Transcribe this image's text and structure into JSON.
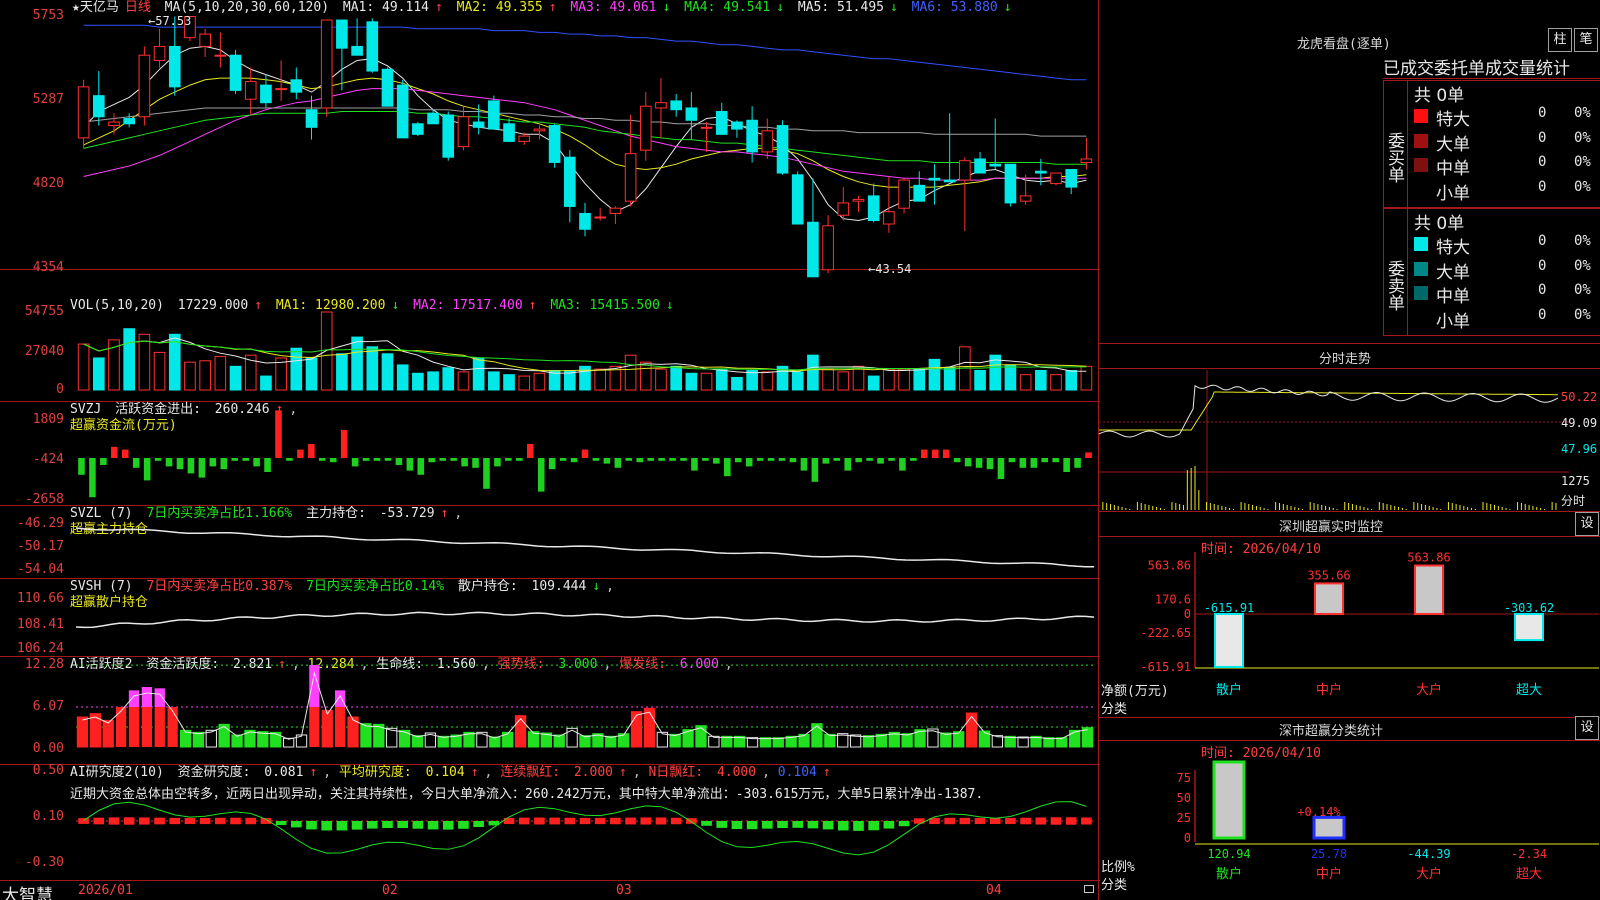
{
  "stock": {
    "name": "★天亿马",
    "period": "日线"
  },
  "kline": {
    "header": {
      "ma_label": "MA(5,10,20,30,60,120)",
      "ma1": "MA1: 49.114",
      "ma2": "MA2: 49.355",
      "ma3": "MA3: 49.061",
      "ma4": "MA4: 49.541",
      "ma5": "MA5: 51.495",
      "ma6": "MA6: 53.880"
    },
    "yticks": [
      "5753",
      "5287",
      "4820",
      "4354"
    ],
    "high_label": "57.53",
    "low_label": "43.54",
    "candles": [
      [
        50.6,
        53.9,
        50.0,
        53.5
      ],
      [
        53.0,
        54.4,
        51.3,
        51.8
      ],
      [
        51.3,
        52.0,
        50.8,
        51.5
      ],
      [
        51.7,
        52.0,
        51.2,
        51.4
      ],
      [
        51.8,
        55.8,
        51.3,
        55.3
      ],
      [
        55.0,
        56.8,
        54.6,
        55.8
      ],
      [
        55.8,
        57.5,
        53.0,
        53.5
      ],
      [
        56.3,
        57.5,
        56.1,
        57.5
      ],
      [
        55.8,
        56.8,
        55.2,
        56.5
      ],
      [
        55.3,
        56.6,
        54.6,
        55.3
      ],
      [
        55.3,
        55.6,
        53.1,
        53.3
      ],
      [
        52.8,
        54.6,
        51.9,
        53.8
      ],
      [
        53.6,
        54.2,
        52.3,
        52.6
      ],
      [
        53.4,
        55.0,
        52.7,
        53.4
      ],
      [
        53.9,
        54.6,
        52.8,
        53.2
      ],
      [
        52.2,
        53.0,
        50.5,
        51.2
      ],
      [
        52.3,
        57.3,
        51.8,
        57.3
      ],
      [
        57.3,
        57.3,
        53.3,
        55.7
      ],
      [
        55.8,
        57.4,
        55.3,
        55.3
      ],
      [
        57.2,
        57.4,
        54.3,
        54.4
      ],
      [
        54.5,
        54.6,
        52.7,
        52.4
      ],
      [
        53.6,
        53.9,
        51.0,
        50.6
      ],
      [
        51.4,
        51.5,
        50.7,
        50.8
      ],
      [
        52.0,
        52.2,
        51.5,
        51.4
      ],
      [
        51.9,
        52.1,
        49.3,
        49.5
      ],
      [
        50.1,
        52.4,
        49.9,
        51.8
      ],
      [
        51.5,
        52.5,
        50.8,
        51.2
      ],
      [
        52.7,
        53.0,
        51.6,
        51.1
      ],
      [
        51.4,
        51.7,
        50.4,
        50.4
      ],
      [
        50.4,
        50.9,
        50.2,
        50.7
      ],
      [
        51.0,
        51.3,
        50.5,
        51.1
      ],
      [
        51.3,
        51.4,
        48.9,
        49.2
      ],
      [
        49.5,
        49.9,
        45.8,
        46.7
      ],
      [
        46.3,
        46.9,
        45.0,
        45.4
      ],
      [
        46.1,
        46.6,
        45.9,
        46.1
      ],
      [
        46.3,
        46.7,
        45.7,
        46.6
      ],
      [
        47.0,
        51.9,
        46.7,
        49.7
      ],
      [
        49.9,
        53.2,
        49.3,
        52.4
      ],
      [
        52.3,
        54.0,
        50.6,
        52.6
      ],
      [
        52.7,
        53.1,
        51.8,
        52.2
      ],
      [
        52.3,
        53.2,
        50.5,
        51.6
      ],
      [
        51.2,
        51.5,
        49.8,
        51.2
      ],
      [
        52.1,
        52.6,
        51.0,
        50.8
      ],
      [
        51.5,
        51.6,
        50.6,
        51.1
      ],
      [
        51.6,
        52.4,
        49.2,
        49.8
      ],
      [
        49.8,
        51.7,
        49.4,
        51.0
      ],
      [
        51.3,
        51.6,
        48.5,
        48.6
      ],
      [
        48.5,
        48.7,
        45.7,
        45.7
      ],
      [
        45.8,
        48.3,
        44.0,
        42.7
      ],
      [
        43.1,
        46.2,
        42.9,
        45.6
      ],
      [
        46.2,
        47.8,
        45.9,
        46.9
      ],
      [
        47.0,
        47.3,
        46.4,
        47.1
      ],
      [
        47.3,
        48.0,
        45.8,
        45.9
      ],
      [
        45.7,
        48.4,
        45.2,
        46.4
      ],
      [
        46.6,
        48.3,
        46.3,
        48.2
      ],
      [
        47.9,
        48.7,
        47.2,
        47.0
      ],
      [
        48.3,
        49.1,
        46.8,
        48.2
      ],
      [
        48.2,
        52.0,
        48.2,
        48.1
      ],
      [
        48.2,
        49.5,
        45.3,
        49.3
      ],
      [
        49.4,
        49.8,
        48.8,
        48.6
      ],
      [
        49.1,
        51.7,
        48.8,
        49.0
      ],
      [
        49.1,
        49.1,
        46.7,
        46.9
      ],
      [
        47.0,
        48.5,
        46.8,
        47.3
      ],
      [
        48.7,
        49.4,
        47.9,
        48.6
      ],
      [
        48.0,
        48.5,
        47.9,
        48.6
      ],
      [
        48.8,
        48.8,
        47.4,
        47.8
      ],
      [
        49.2,
        50.6,
        48.8,
        49.4
      ]
    ],
    "ma_lines": {
      "ma1": [
        51.2,
        52.1,
        52.5,
        52.9,
        53.6,
        54.5,
        55.3,
        55.7,
        55.8,
        55.6,
        55.0,
        54.5,
        54.2,
        53.9,
        53.6,
        53.2,
        53.8,
        54.5,
        55.0,
        55.1,
        54.7,
        54.0,
        53.0,
        52.2,
        51.6,
        51.4,
        51.2,
        51.1,
        51.0,
        50.8,
        50.8,
        50.3,
        49.1,
        48.0,
        47.1,
        46.4,
        46.8,
        47.7,
        48.9,
        50.1,
        51.2,
        51.7,
        51.8,
        51.4,
        51.0,
        50.7,
        50.2,
        49.4,
        48.2,
        46.8,
        46.0,
        45.9,
        46.1,
        46.6,
        47.0,
        47.1,
        47.6,
        48.0,
        48.4,
        48.7,
        48.8,
        48.5,
        48.2,
        48.1,
        48.2,
        48.0,
        48.2
      ],
      "ma2": [
        50.2,
        50.6,
        51.0,
        51.6,
        52.2,
        52.8,
        53.2,
        53.6,
        53.9,
        54.0,
        54.0,
        54.0,
        53.9,
        53.8,
        53.6,
        53.4,
        53.5,
        53.7,
        53.9,
        54.0,
        53.9,
        53.7,
        53.4,
        53.1,
        52.7,
        52.4,
        52.2,
        52.0,
        51.8,
        51.6,
        51.4,
        51.1,
        50.7,
        50.2,
        49.6,
        49.1,
        48.9,
        48.8,
        48.9,
        49.1,
        49.4,
        49.6,
        49.8,
        49.9,
        50.0,
        50.0,
        49.9,
        49.7,
        49.3,
        48.8,
        48.4,
        48.1,
        47.9,
        47.8,
        47.8,
        47.8,
        47.8,
        47.9,
        48.0,
        48.1,
        48.3,
        48.3,
        48.3,
        48.3,
        48.4,
        48.4,
        48.5
      ],
      "ma3": [
        48.4,
        48.6,
        48.8,
        49.0,
        49.3,
        49.6,
        50.0,
        50.4,
        50.8,
        51.2,
        51.6,
        51.9,
        52.2,
        52.4,
        52.6,
        52.7,
        52.9,
        53.1,
        53.3,
        53.4,
        53.4,
        53.4,
        53.3,
        53.2,
        53.1,
        53.0,
        52.9,
        52.8,
        52.7,
        52.6,
        52.4,
        52.2,
        51.9,
        51.6,
        51.3,
        51.0,
        50.7,
        50.5,
        50.3,
        50.1,
        50.0,
        49.9,
        49.8,
        49.8,
        49.7,
        49.6,
        49.5,
        49.3,
        49.1,
        48.9,
        48.7,
        48.6,
        48.5,
        48.4,
        48.3,
        48.3,
        48.2,
        48.2,
        48.2,
        48.2,
        48.3,
        48.3,
        48.3,
        48.3,
        48.3,
        48.3,
        48.3
      ],
      "ma4": [
        50.0,
        50.2,
        50.4,
        50.6,
        50.8,
        51.0,
        51.2,
        51.4,
        51.6,
        51.7,
        51.8,
        51.9,
        52.0,
        52.0,
        52.0,
        52.0,
        52.0,
        52.1,
        52.1,
        52.1,
        52.1,
        52.1,
        52.0,
        52.0,
        51.9,
        51.8,
        51.8,
        51.7,
        51.6,
        51.5,
        51.5,
        51.4,
        51.3,
        51.2,
        51.0,
        50.9,
        50.8,
        50.7,
        50.6,
        50.5,
        50.5,
        50.4,
        50.3,
        50.3,
        50.2,
        50.1,
        50.0,
        49.9,
        49.8,
        49.7,
        49.6,
        49.5,
        49.4,
        49.3,
        49.3,
        49.3,
        49.2,
        49.2,
        49.2,
        49.2,
        49.2,
        49.2,
        49.2,
        49.2,
        49.1,
        49.1,
        49.1
      ],
      "ma5": [
        51.5,
        51.6,
        51.7,
        51.8,
        51.9,
        52.0,
        52.1,
        52.2,
        52.3,
        52.3,
        52.3,
        52.3,
        52.3,
        52.3,
        52.3,
        52.3,
        52.3,
        52.3,
        52.3,
        52.3,
        52.3,
        52.3,
        52.2,
        52.2,
        52.2,
        52.1,
        52.1,
        52.0,
        52.0,
        51.9,
        51.9,
        51.8,
        51.8,
        51.7,
        51.7,
        51.6,
        51.6,
        51.5,
        51.5,
        51.4,
        51.4,
        51.4,
        51.3,
        51.3,
        51.2,
        51.2,
        51.1,
        51.1,
        51.0,
        51.0,
        51.0,
        50.9,
        50.9,
        50.9,
        50.9,
        50.9,
        50.8,
        50.8,
        50.8,
        50.8,
        50.8,
        50.8,
        50.8,
        50.7,
        50.7,
        50.7,
        50.7
      ],
      "ma6": [
        57.0,
        57.0,
        57.0,
        57.0,
        57.0,
        56.9,
        56.9,
        56.9,
        56.9,
        56.9,
        56.9,
        56.9,
        56.9,
        56.9,
        56.9,
        56.9,
        56.9,
        56.9,
        56.9,
        56.9,
        56.9,
        56.9,
        56.8,
        56.8,
        56.8,
        56.8,
        56.8,
        56.7,
        56.7,
        56.7,
        56.6,
        56.6,
        56.5,
        56.5,
        56.4,
        56.4,
        56.3,
        56.3,
        56.2,
        56.1,
        56.1,
        56.0,
        55.9,
        55.9,
        55.8,
        55.7,
        55.6,
        55.6,
        55.5,
        55.4,
        55.3,
        55.2,
        55.1,
        55.1,
        55.0,
        54.9,
        54.8,
        54.7,
        54.6,
        54.5,
        54.4,
        54.3,
        54.2,
        54.1,
        54.0,
        53.9,
        53.9
      ]
    }
  },
  "vol": {
    "header": {
      "label": "VOL(5,10,20)",
      "value": "17229.000",
      "ma1": "MA1: 12980.200",
      "ma2": "MA2: 17517.400",
      "ma3": "MA3: 15415.500"
    },
    "yticks": [
      "54755",
      "27040",
      "0"
    ],
    "values": [
      33000,
      23000,
      36000,
      44000,
      40000,
      27000,
      40000,
      20000,
      21000,
      24000,
      17000,
      25000,
      10000,
      23000,
      30000,
      23000,
      56000,
      26000,
      38000,
      31000,
      26000,
      18000,
      12000,
      13000,
      16000,
      13000,
      23000,
      13000,
      11000,
      10000,
      12000,
      14000,
      14000,
      17000,
      15000,
      17000,
      25000,
      20000,
      15000,
      17000,
      12000,
      12000,
      15000,
      9000,
      14000,
      13000,
      17000,
      13000,
      25000,
      15000,
      13000,
      17000,
      10000,
      15000,
      15000,
      15000,
      22000,
      16000,
      31000,
      14000,
      25000,
      18000,
      11000,
      14000,
      11000,
      14000,
      17000
    ]
  },
  "svzj": {
    "header": {
      "label": "SVZJ",
      "title": "活跃资金进出:",
      "value": "260.246"
    },
    "subtitle": "超赢资金流(万元)",
    "yticks": [
      "1809",
      "-424",
      "-2658"
    ],
    "values": [
      -600,
      -1400,
      -250,
      400,
      300,
      -350,
      -800,
      -100,
      -300,
      -400,
      -550,
      -700,
      -300,
      -400,
      -100,
      -100,
      -300,
      -500,
      1700,
      -100,
      300,
      500,
      -100,
      -150,
      1000,
      -300,
      -100,
      -100,
      -100,
      -250,
      -450,
      -600,
      -150,
      -100,
      -100,
      -300,
      -350,
      -1100,
      -300,
      -100,
      -100,
      500,
      -1200,
      -400,
      -100,
      -150,
      300,
      -100,
      -200,
      -350,
      -100,
      -150,
      -100,
      -100,
      -100,
      -100,
      -450,
      -100,
      -200,
      -650,
      -150,
      -300,
      -100,
      -100,
      -100,
      -150,
      -450,
      -850,
      -200,
      -100,
      -450,
      -150,
      -100,
      -200,
      -100,
      -450,
      -100,
      300,
      300,
      300,
      -150,
      -300,
      -350,
      -400,
      -750,
      -150,
      -350,
      -350,
      -150,
      -150,
      -500,
      -350,
      200
    ]
  },
  "svzl": {
    "header": {
      "label": "SVZL (7)",
      "t1": "7日内买卖净占比1.166%",
      "t2": "主力持仓:",
      "value": "-53.729"
    },
    "subtitle": "超赢主力持仓",
    "yticks": [
      "-46.29",
      "-50.17",
      "-54.04"
    ]
  },
  "svsh": {
    "header": {
      "label": "SVSH (7)",
      "t1": "7日内买卖净占比0.387%",
      "t2": "7日内买卖净占比0.14%",
      "t3": "散户持仓:",
      "value": "109.444"
    },
    "subtitle": "超赢散户持仓",
    "yticks": [
      "110.66",
      "108.41",
      "106.24"
    ]
  },
  "ai1": {
    "header": {
      "label": "AI活跃度2",
      "t1": "资金活跃度:",
      "v1": "2.821",
      "v2": "12.284",
      "t2": "生命线:",
      "v3": "1.560",
      "t3": "强势线:",
      "v4": "3.000",
      "t4": "爆发线:",
      "v5": "6.000"
    },
    "yticks": [
      "12.28",
      "6.07",
      "0.00"
    ],
    "values": [
      4.5,
      5.0,
      4.0,
      6.0,
      8.5,
      9.0,
      8.8,
      6.0,
      2.5,
      2.2,
      2.5,
      3.4,
      1.8,
      2.5,
      2.3,
      2.2,
      1.3,
      1.8,
      12.3,
      5.5,
      8.5,
      4.5,
      3.5,
      3.4,
      2.8,
      2.5,
      1.7,
      2.1,
      1.6,
      1.8,
      2.2,
      2.2,
      1.5,
      2.2,
      4.7,
      2.3,
      2.1,
      1.8,
      2.8,
      1.7,
      2.0,
      1.6,
      2.0,
      5.3,
      5.8,
      2.2,
      1.9,
      2.6,
      3.2,
      1.6,
      1.6,
      1.6,
      1.4,
      1.4,
      1.4,
      1.6,
      1.9,
      3.5,
      1.9,
      2.0,
      1.8,
      1.7,
      1.9,
      2.2,
      2.0,
      2.6,
      2.7,
      2.1,
      2.3,
      5.1,
      2.4,
      1.7,
      1.6,
      1.5,
      1.6,
      1.4,
      1.4,
      2.5,
      2.9
    ]
  },
  "ai2": {
    "header": {
      "label": "AI研究度2(10)",
      "t1": "资金研究度:",
      "v1": "0.081",
      "t2": "平均研究度:",
      "v2": "0.104",
      "t3": "连续飘红:",
      "v3": "2.000",
      "t4": "N日飘红:",
      "v4": "4.000",
      "v5": "0.104"
    },
    "comment": "近期大资金总体由空转多，近两日出现异动，关注其持续性，今日大单净流入：260.242万元，其中特大单净流出：-303.615万元，大单5日累计净出-1387.",
    "yticks": [
      "0.50",
      "0.10",
      "-0.30"
    ]
  },
  "xaxis": {
    "labels": [
      "2026/01",
      "02",
      "03",
      "04"
    ]
  },
  "brand": "大智慧",
  "right": {
    "lhkp": {
      "title": "龙虎看盘(逐单)",
      "btn1": "柱",
      "btn2": "笔",
      "tab1": "已成交",
      "tab2": "委托单",
      "tab3": "成交量统计",
      "buy": {
        "side": "委买单",
        "total": "共 0单",
        "rows": [
          {
            "n": "特大",
            "v": "0",
            "p": "0%",
            "c": "#ff1010"
          },
          {
            "n": "大单",
            "v": "0",
            "p": "0%",
            "c": "#a01010"
          },
          {
            "n": "中单",
            "v": "0",
            "p": "0%",
            "c": "#801010"
          },
          {
            "n": "小单",
            "v": "0",
            "p": "0%",
            "c": "#000000"
          }
        ]
      },
      "sell": {
        "side": "委卖单",
        "total": "共 0单",
        "rows": [
          {
            "n": "特大",
            "v": "0",
            "p": "0%",
            "c": "#00e8e8"
          },
          {
            "n": "大单",
            "v": "0",
            "p": "0%",
            "c": "#008888"
          },
          {
            "n": "中单",
            "v": "0",
            "p": "0%",
            "c": "#006868"
          },
          {
            "n": "小单",
            "v": "0",
            "p": "0%",
            "c": "#000000"
          }
        ]
      }
    },
    "fs": {
      "title": "分时走势",
      "y1": "50.22",
      "y2": "49.09",
      "y3": "47.96",
      "v1": "1275",
      "v2": "分时"
    },
    "monitor": {
      "title": "深圳超赢实时监控",
      "btn": "设",
      "time": "时间: 2026/04/10",
      "yticks": [
        "563.86",
        "170.6",
        "0",
        "-222.65",
        "-615.91"
      ],
      "ylabel": "净额(万元)",
      "xcat": "分类",
      "bars": [
        {
          "cat": "散户",
          "val": -615.91,
          "label": "-615.91"
        },
        {
          "cat": "中户",
          "val": 355.66,
          "label": "355.66"
        },
        {
          "cat": "大户",
          "val": 563.86,
          "label": "563.86"
        },
        {
          "cat": "超大",
          "val": -303.62,
          "label": "-303.62"
        }
      ]
    },
    "stat": {
      "title": "深市超赢分类统计",
      "btn": "设",
      "time": "时间: 2026/04/10",
      "yticks": [
        "75",
        "50",
        "25",
        "0"
      ],
      "ylabel": "比例%",
      "xcat": "分类",
      "mark": "+0.14%",
      "bars": [
        {
          "cat": "散户",
          "val": 120.94,
          "label": "120.94"
        },
        {
          "cat": "中户",
          "val": 25.78,
          "label": "25.78"
        },
        {
          "cat": "大户",
          "val": -44.39,
          "label": "-44.39"
        },
        {
          "cat": "超大",
          "val": -2.34,
          "label": "-2.34"
        }
      ]
    }
  }
}
